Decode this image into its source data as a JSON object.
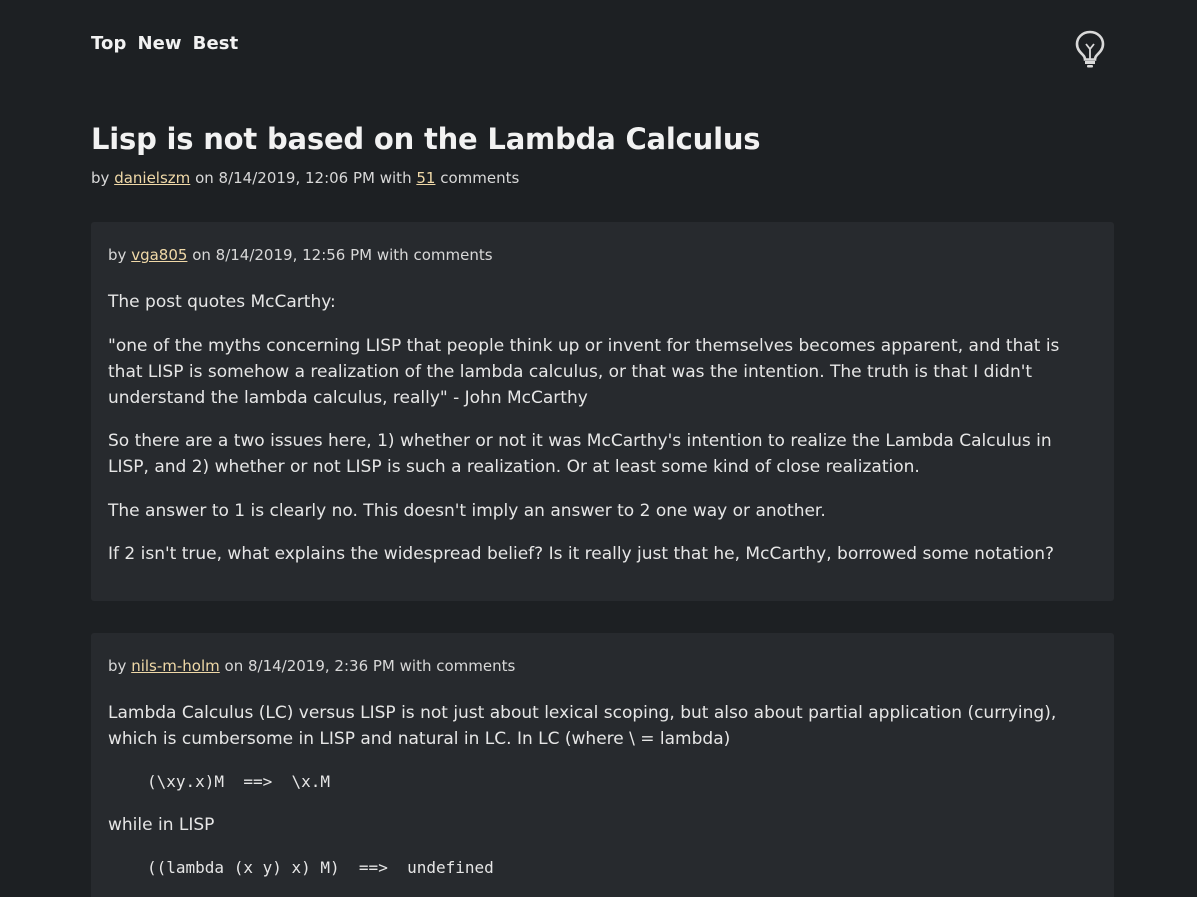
{
  "nav": {
    "top": "Top",
    "new": "New",
    "best": "Best"
  },
  "theme_toggle_icon": "lightbulb-icon",
  "story": {
    "title": "Lisp is not based on the Lambda Calculus",
    "by_label": "by",
    "author": "danielszm",
    "on_label": "on",
    "date": "8/14/2019, 12:06 PM",
    "with_label": "with",
    "comment_count": "51",
    "comments_label": "comments"
  },
  "comments": [
    {
      "by_label": "by",
      "author": "vga805",
      "rest": "on 8/14/2019, 12:56 PM with comments",
      "paragraphs": [
        "The post quotes McCarthy:",
        "\"one of the myths concerning LISP that people think up or invent for themselves becomes apparent, and that is that LISP is somehow a realization of the lambda calculus, or that was the intention. The truth is that I didn't understand the lambda calculus, really\" - John McCarthy",
        "So there are a two issues here, 1) whether or not it was McCarthy's intention to realize the Lambda Calculus in LISP, and 2) whether or not LISP is such a realization. Or at least some kind of close realization.",
        "The answer to 1 is clearly no. This doesn't imply an answer to 2 one way or another.",
        "If 2 isn't true, what explains the widespread belief? Is it really just that he, McCarthy, borrowed some notation?"
      ]
    },
    {
      "by_label": "by",
      "author": "nils-m-holm",
      "rest": "on 8/14/2019, 2:36 PM with comments",
      "paragraphs": [
        "Lambda Calculus (LC) versus LISP is not just about lexical scoping, but also about partial application (currying), which is cumbersome in LISP and natural in LC. In LC (where \\ = lambda)",
        "while in LISP"
      ],
      "code": [
        "(\\xy.x)M  ==>  \\x.M",
        "((lambda (x y) x) M)  ==>  undefined"
      ]
    }
  ]
}
